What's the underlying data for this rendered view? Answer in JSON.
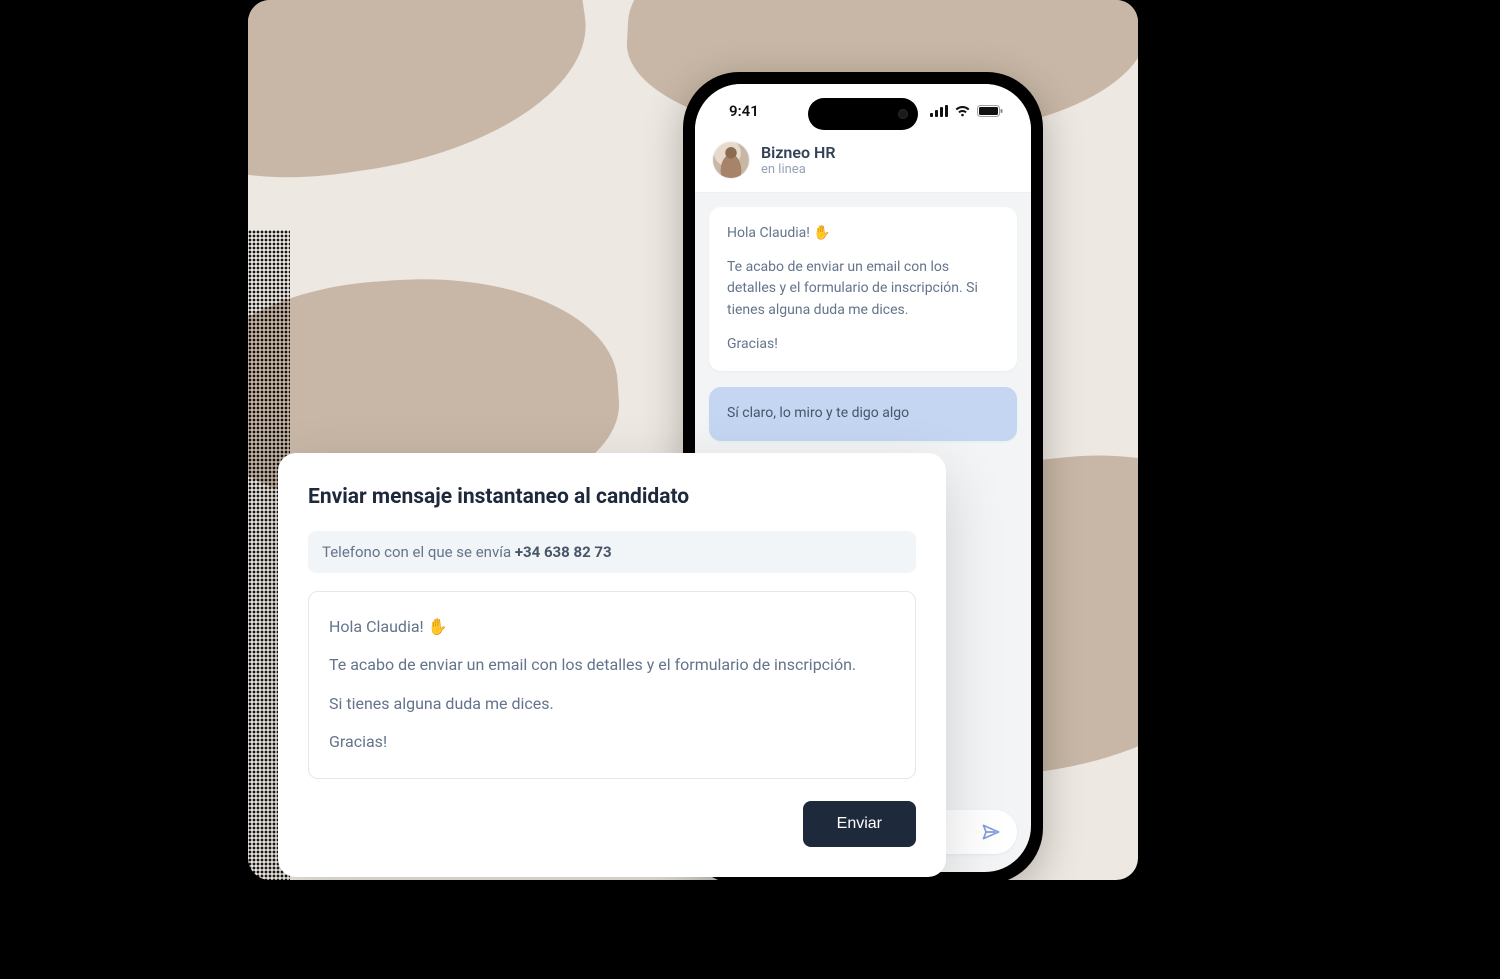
{
  "phone": {
    "time": "9:41",
    "chatTitle": "Bizneo HR",
    "chatStatus": "en linea",
    "messages": {
      "incoming": {
        "line1": "Hola Claudia! ✋",
        "line2": "Te acabo de enviar un email con los detalles y el formulario de inscripción. Si tienes alguna duda me dices.",
        "line3": "Gracias!"
      },
      "reply": "Sí claro, lo miro y te digo algo"
    }
  },
  "card": {
    "title": "Enviar mensaje instantaneo al candidato",
    "phoneLabel": "Telefono con el que se envía ",
    "phoneNumber": "+34 638 82 73",
    "body": {
      "line1": "Hola Claudia! ✋",
      "line2": "Te acabo de enviar un email con los detalles y el formulario de inscripción.",
      "line3": "Si tienes alguna duda me dices.",
      "line4": "Gracias!"
    },
    "sendLabel": "Enviar"
  }
}
